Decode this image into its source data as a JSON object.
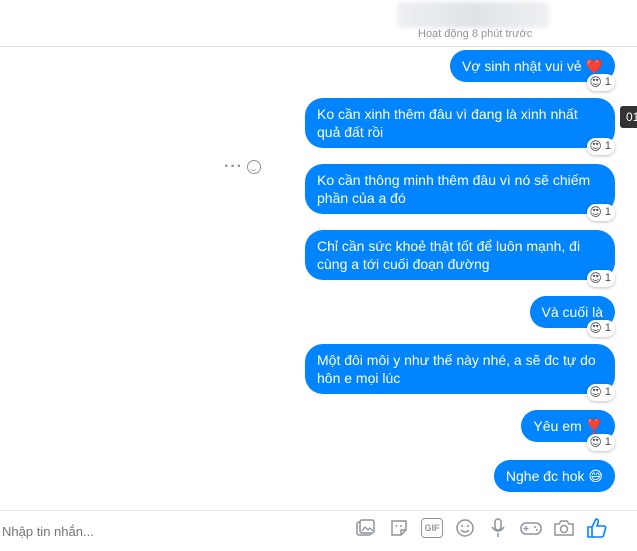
{
  "header": {
    "status": "Hoạt động 8 phút trước"
  },
  "tooltip": "01",
  "messages": [
    {
      "text": "Vợ sinh nhật vui vẻ ❤️",
      "reaction_emoji": "😍",
      "reaction_count": "1"
    },
    {
      "text": "Ko cần xinh thêm đâu vì đang là xinh nhất quả đất rồi",
      "reaction_emoji": "😍",
      "reaction_count": "1"
    },
    {
      "text": "Ko cần thông minh thêm đâu vì nó sẽ chiếm phần của a đó",
      "reaction_emoji": "😍",
      "reaction_count": "1"
    },
    {
      "text": "Chỉ cần sức khoẻ thật tốt để luôn mạnh, đi cùng a tới cuối đoạn đường",
      "reaction_emoji": "😍",
      "reaction_count": "1"
    },
    {
      "text": "Và cuối là",
      "reaction_emoji": "😍",
      "reaction_count": "1"
    },
    {
      "text": "Một đôi môi y như thế này nhé, a sẽ đc tự do hôn e mọi lúc",
      "reaction_emoji": "😍",
      "reaction_count": "1"
    },
    {
      "text": "Yêu em ❣️",
      "reaction_emoji": "😍",
      "reaction_count": "1"
    },
    {
      "text": "Nghe đc hok 😅"
    }
  ],
  "composer": {
    "placeholder": "Nhập tin nhắn...",
    "tools": [
      "photo-icon",
      "sticker-icon",
      "gif-icon",
      "emoji-icon",
      "microphone-icon",
      "game-controller-icon",
      "camera-icon",
      "like-icon"
    ],
    "gif_label": "GIF"
  },
  "colors": {
    "bubble": "#0084ff",
    "muted": "#90949c"
  }
}
